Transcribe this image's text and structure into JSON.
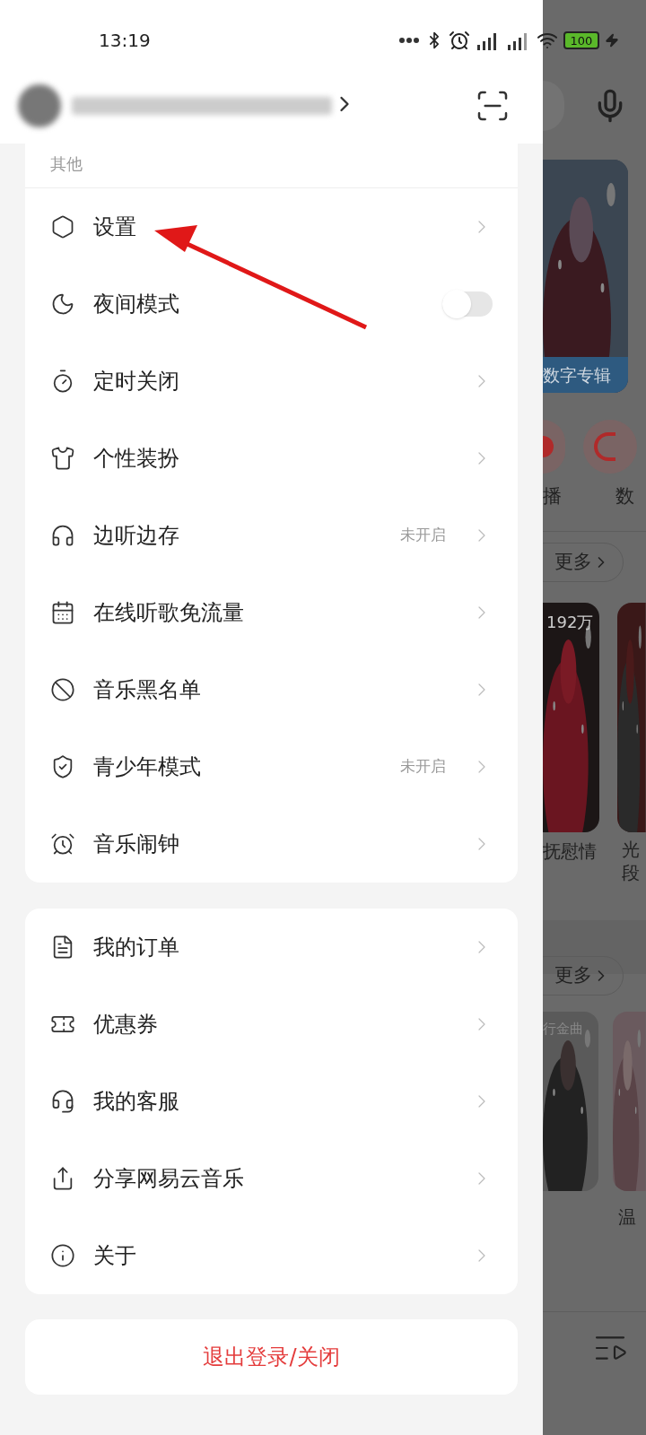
{
  "status_bar": {
    "time": "13:19",
    "battery": "100"
  },
  "drawer": {
    "section_title": "其他",
    "groups": [
      [
        {
          "kind": "link",
          "label": "设置"
        },
        {
          "kind": "toggle",
          "label": "夜间模式",
          "on": false
        },
        {
          "kind": "link",
          "label": "定时关闭"
        },
        {
          "kind": "link",
          "label": "个性装扮"
        },
        {
          "kind": "link",
          "label": "边听边存",
          "status": "未开启"
        },
        {
          "kind": "link",
          "label": "在线听歌免流量"
        },
        {
          "kind": "link",
          "label": "音乐黑名单"
        },
        {
          "kind": "link",
          "label": "青少年模式",
          "status": "未开启"
        },
        {
          "kind": "link",
          "label": "音乐闹钟"
        }
      ],
      [
        {
          "kind": "link",
          "label": "我的订单"
        },
        {
          "kind": "link",
          "label": "优惠券"
        },
        {
          "kind": "link",
          "label": "我的客服"
        },
        {
          "kind": "link",
          "label": "分享网易云音乐"
        },
        {
          "kind": "link",
          "label": "关于"
        }
      ]
    ],
    "logout": "退出登录/关闭"
  },
  "background": {
    "album_label": "数字专辑",
    "shortcuts": [
      "播",
      "数"
    ],
    "more": [
      "更多",
      "更多"
    ],
    "play_count": "192万",
    "titles_1": [
      "抚慰情",
      "光",
      "段"
    ],
    "tag": "行金曲",
    "titles_2": [
      "温"
    ]
  }
}
